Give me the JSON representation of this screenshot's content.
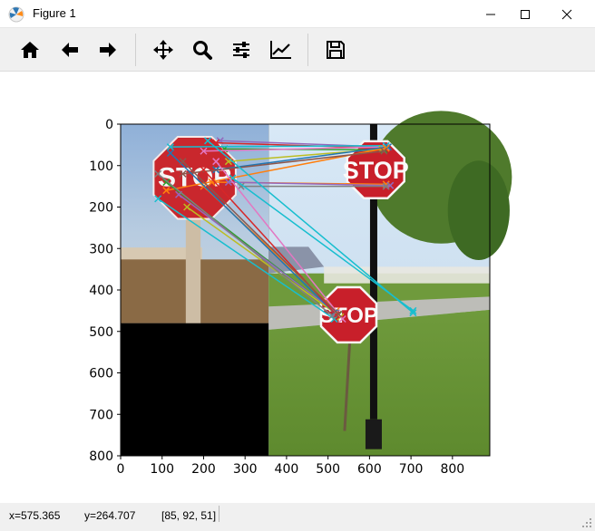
{
  "window": {
    "title": "Figure 1"
  },
  "toolbar": {
    "home": "home-icon",
    "back": "arrow-left-icon",
    "forward": "arrow-right-icon",
    "pan": "move-icon",
    "zoom": "zoom-icon",
    "configure": "sliders-icon",
    "edit": "chart-icon",
    "save": "save-icon"
  },
  "status": {
    "x": "x=575.365",
    "y": "y=264.707",
    "rgb": "[85, 92, 51]"
  },
  "colors": {
    "toolbar_bg": "#f0f0f0",
    "axes_edge": "#000000"
  },
  "chart_data": {
    "type": "image",
    "xlim": [
      0,
      890
    ],
    "ylim": [
      800,
      0
    ],
    "xticks": [
      "0",
      "100",
      "200",
      "300",
      "400",
      "500",
      "600",
      "700",
      "800"
    ],
    "yticks": [
      "0",
      "100",
      "200",
      "300",
      "400",
      "500",
      "600",
      "700",
      "800"
    ],
    "images": [
      {
        "name": "left-stop-sign-photo",
        "x": [
          0,
          357
        ],
        "y": [
          0,
          480
        ]
      },
      {
        "name": "right-stop-signs-photo",
        "x": [
          357,
          890
        ],
        "y": [
          0,
          800
        ]
      }
    ],
    "match_lines": [
      {
        "x1": 240,
        "y1": 40,
        "x2": 640,
        "y2": 55,
        "color": "#9467bd"
      },
      {
        "x1": 230,
        "y1": 45,
        "x2": 640,
        "y2": 58,
        "color": "#d62728"
      },
      {
        "x1": 250,
        "y1": 60,
        "x2": 635,
        "y2": 62,
        "color": "#2ca02c"
      },
      {
        "x1": 200,
        "y1": 65,
        "x2": 640,
        "y2": 55,
        "color": "#e377c2"
      },
      {
        "x1": 120,
        "y1": 55,
        "x2": 640,
        "y2": 52,
        "color": "#17becf"
      },
      {
        "x1": 260,
        "y1": 90,
        "x2": 630,
        "y2": 60,
        "color": "#bcbd22"
      },
      {
        "x1": 230,
        "y1": 110,
        "x2": 645,
        "y2": 55,
        "color": "#1f77b4"
      },
      {
        "x1": 110,
        "y1": 160,
        "x2": 640,
        "y2": 58,
        "color": "#ff7f0e"
      },
      {
        "x1": 150,
        "y1": 120,
        "x2": 635,
        "y2": 65,
        "color": "#8c564b"
      },
      {
        "x1": 220,
        "y1": 140,
        "x2": 640,
        "y2": 145,
        "color": "#ff7f0e"
      },
      {
        "x1": 260,
        "y1": 140,
        "x2": 650,
        "y2": 148,
        "color": "#9467bd"
      },
      {
        "x1": 290,
        "y1": 150,
        "x2": 640,
        "y2": 150,
        "color": "#7f7f7f"
      },
      {
        "x1": 210,
        "y1": 40,
        "x2": 705,
        "y2": 455,
        "color": "#17becf"
      },
      {
        "x1": 270,
        "y1": 130,
        "x2": 705,
        "y2": 450,
        "color": "#17becf"
      },
      {
        "x1": 110,
        "y1": 140,
        "x2": 525,
        "y2": 460,
        "color": "#2ca02c"
      },
      {
        "x1": 140,
        "y1": 170,
        "x2": 520,
        "y2": 455,
        "color": "#9467bd"
      },
      {
        "x1": 90,
        "y1": 180,
        "x2": 515,
        "y2": 470,
        "color": "#17becf"
      },
      {
        "x1": 160,
        "y1": 200,
        "x2": 530,
        "y2": 465,
        "color": "#bcbd22"
      },
      {
        "x1": 200,
        "y1": 150,
        "x2": 520,
        "y2": 450,
        "color": "#ff7f0e"
      },
      {
        "x1": 230,
        "y1": 90,
        "x2": 535,
        "y2": 470,
        "color": "#e377c2"
      },
      {
        "x1": 120,
        "y1": 70,
        "x2": 515,
        "y2": 455,
        "color": "#1f77b4"
      },
      {
        "x1": 200,
        "y1": 110,
        "x2": 520,
        "y2": 460,
        "color": "#d62728"
      },
      {
        "x1": 150,
        "y1": 90,
        "x2": 525,
        "y2": 458,
        "color": "#8c564b"
      },
      {
        "x1": 90,
        "y1": 120,
        "x2": 510,
        "y2": 462,
        "color": "#7f7f7f"
      }
    ]
  }
}
